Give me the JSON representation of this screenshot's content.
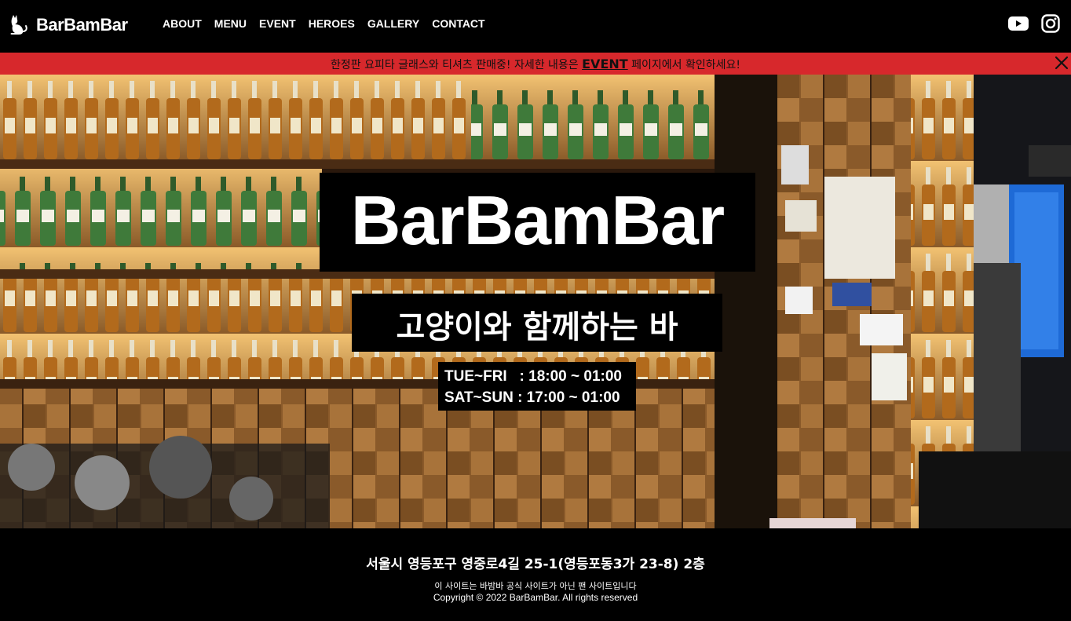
{
  "nav": {
    "brand": "BarBamBar",
    "brand_icon": "cat-icon",
    "items": [
      "ABOUT",
      "MENU",
      "EVENT",
      "HEROES",
      "GALLERY",
      "CONTACT"
    ],
    "social": [
      "youtube-icon",
      "instagram-icon"
    ]
  },
  "notice": {
    "before": "한정판 요피타 글래스와 티셔츠 판매중! 자세한 내용은 ",
    "link": "EVENT",
    "after": " 페이지에서 확인하세요!",
    "close_icon": "close-icon",
    "background": "#d7282c"
  },
  "hero": {
    "title": "BarBamBar",
    "subtitle": "고양이와 함께하는 바",
    "hours": [
      "TUE~FRI   : 18:00 ~ 01:00",
      "SAT~SUN : 17:00 ~ 01:00"
    ]
  },
  "footer": {
    "address": "서울시 영등포구 영중로4길 25-1(영등포동3가 23-8) 2층",
    "fan_note": "이 사이트는 바밤바 공식 사이트가 아닌 팬 사이트입니다",
    "copyright": "Copyright © 2022 BarBamBar. All rights reserved"
  }
}
